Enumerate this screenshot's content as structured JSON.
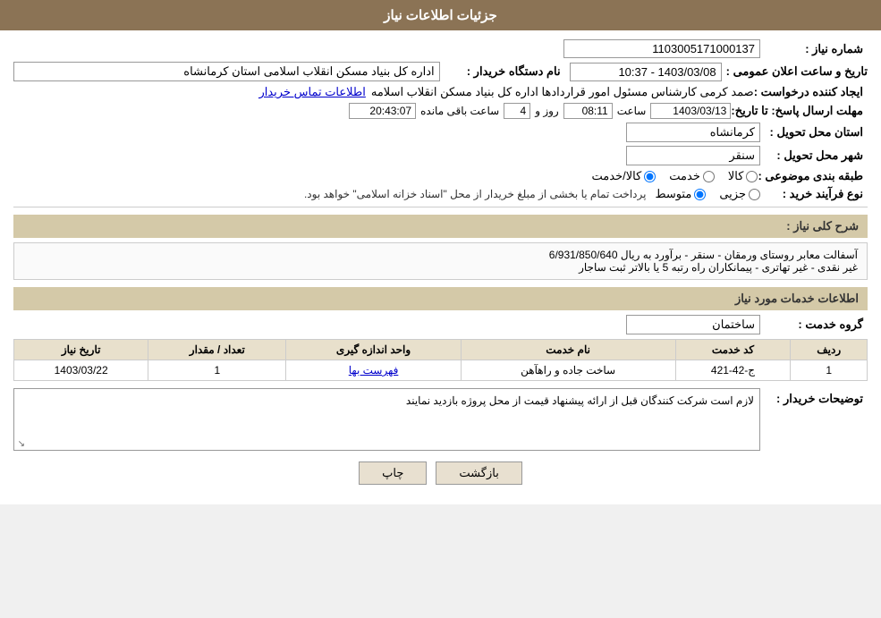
{
  "header": {
    "title": "جزئیات اطلاعات نیاز"
  },
  "need_number_label": "شماره نیاز :",
  "need_number_value": "1103005171000137",
  "buyer_org_label": "نام دستگاه خریدار :",
  "buyer_org_value": "اداره کل بنیاد مسکن انقلاب اسلامی استان کرمانشاه",
  "creator_label": "ایجاد کننده درخواست :",
  "creator_value": "صمد کرمی کارشناس مسئول امور قراردادها اداره کل بنیاد مسکن انقلاب اسلامه",
  "contact_link": "اطلاعات تماس خریدار",
  "date_label": "تاریخ و ساعت اعلان عمومی :",
  "date_value": "1403/03/08 - 10:37",
  "reply_deadline_label": "مهلت ارسال پاسخ: تا تاریخ:",
  "deadline_date": "1403/03/13",
  "deadline_time_label": "ساعت",
  "deadline_time": "08:11",
  "deadline_days_label": "روز و",
  "deadline_days": "4",
  "remaining_label": "ساعت باقی مانده",
  "remaining_time": "20:43:07",
  "province_label": "استان محل تحویل :",
  "province_value": "کرمانشاه",
  "city_label": "شهر محل تحویل :",
  "city_value": "سنقر",
  "category_label": "طبقه بندی موضوعی :",
  "category_options": [
    "کالا",
    "خدمت",
    "کالا/خدمت"
  ],
  "category_selected": "کالا",
  "process_label": "نوع فرآیند خرید :",
  "process_options": [
    "جزیی",
    "متوسط"
  ],
  "process_note": "پرداخت تمام یا بخشی از مبلغ خریدار از محل \"اسناد خزانه اسلامی\" خواهد بود.",
  "need_description_label": "شرح کلی نیاز :",
  "need_description": "آسفالت معابر روستای ورمقان - سنقر - برآورد به ریال  6/931/850/640\nغیر نقدی - غیر تهاتری - پیمانکاران راه رتبه 5 یا بالاتر ثبت ساجار",
  "services_section_label": "اطلاعات خدمات مورد نیاز",
  "service_group_label": "گروه خدمت :",
  "service_group_value": "ساختمان",
  "services_table": {
    "columns": [
      "ردیف",
      "کد خدمت",
      "نام خدمت",
      "واحد اندازه گیری",
      "تعداد / مقدار",
      "تاریخ نیاز"
    ],
    "rows": [
      {
        "row_num": "1",
        "code": "ج-42-421",
        "name": "ساخت جاده و راهآهن",
        "unit": "فهرست بها",
        "quantity": "1",
        "date": "1403/03/22"
      }
    ]
  },
  "buyer_notes_label": "توضیحات خریدار :",
  "buyer_notes_value": "لازم است شرکت کنندگان قبل از ارائه پیشنهاد قیمت از محل پروژه بازدید نمایند",
  "btn_print": "چاپ",
  "btn_back": "بازگشت"
}
